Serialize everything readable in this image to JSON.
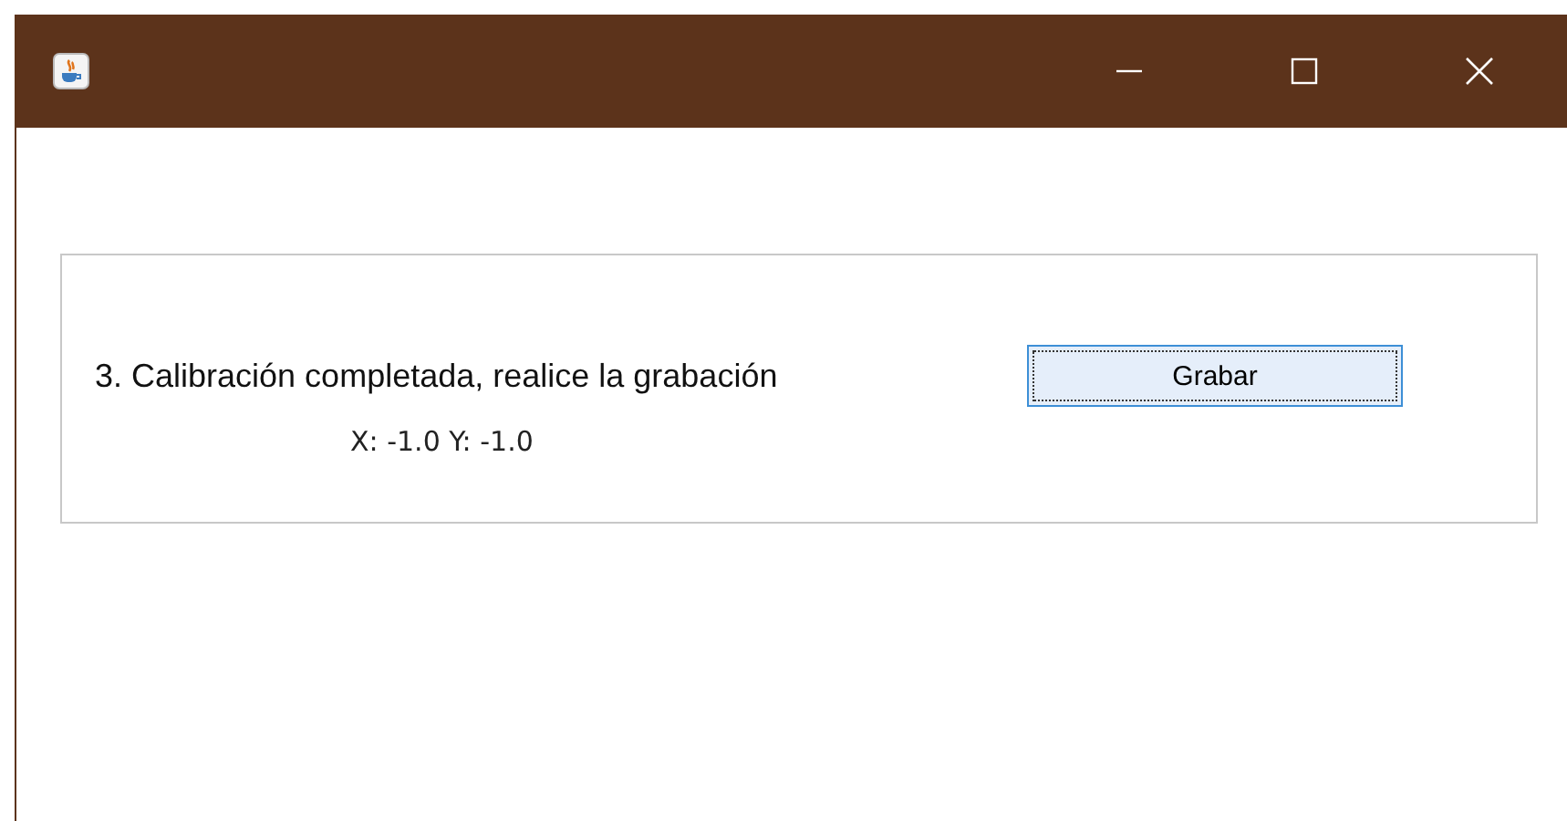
{
  "panel": {
    "instruction": "3. Calibración completada, realice la grabación",
    "coordinates": "X: -1.0 Y: -1.0",
    "button": {
      "label": "Grabar",
      "focused": true
    }
  }
}
